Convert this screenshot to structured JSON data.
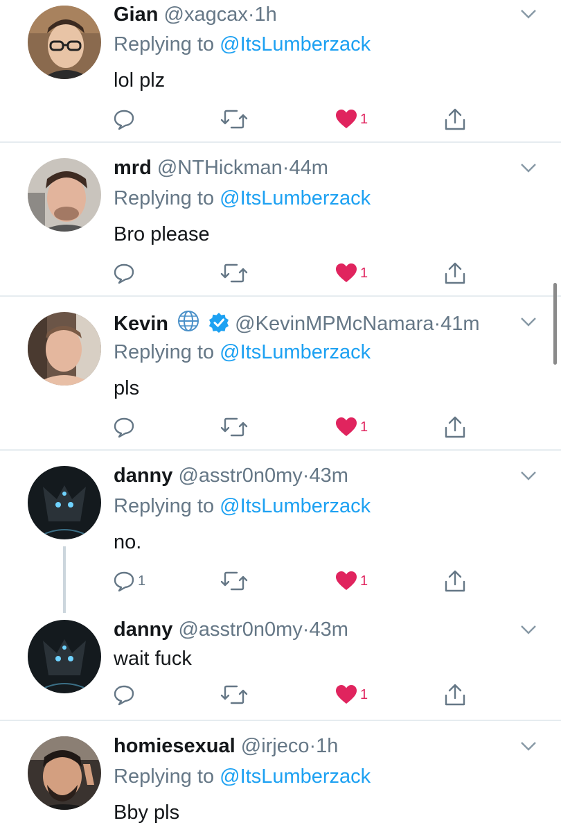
{
  "mention": "@ItsLumberzack",
  "replying_prefix": "Replying to",
  "tweets": [
    {
      "name": "Gian",
      "handle": "@xagcax",
      "time": "1h",
      "text": "lol plz",
      "show_reply": true,
      "like_count": "1",
      "reply_count": ""
    },
    {
      "name": "mrd",
      "handle": "@NTHickman",
      "time": "44m",
      "text": "Bro please",
      "show_reply": true,
      "like_count": "1",
      "reply_count": ""
    },
    {
      "name": "Kevin",
      "handle": "@KevinMPMcNamara",
      "time": "41m",
      "text": "pls",
      "show_reply": true,
      "like_count": "1",
      "reply_count": ""
    },
    {
      "name": "danny",
      "handle": "@asstr0n0my",
      "time": "43m",
      "text": "no.",
      "show_reply": true,
      "like_count": "1",
      "reply_count": "1"
    },
    {
      "name": "danny",
      "handle": "@asstr0n0my",
      "time": "43m",
      "text": "wait fuck",
      "show_reply": false,
      "like_count": "1",
      "reply_count": ""
    },
    {
      "name": "homiesexual",
      "handle": "@irjeco",
      "time": "1h",
      "text": "Bby pls",
      "show_reply": true,
      "like_count": "",
      "reply_count": ""
    }
  ],
  "separator": "·",
  "icons": {
    "reply": "reply-icon",
    "retweet": "retweet-icon",
    "like": "heart-icon",
    "share": "share-icon",
    "caret": "chevron-down-icon",
    "globe": "globe-icon",
    "verified": "verified-badge-icon"
  },
  "colors": {
    "accent": "#1da1f2",
    "like": "#e0245e",
    "muted": "#657786",
    "text": "#14171a",
    "divider": "#e6ecf0"
  }
}
